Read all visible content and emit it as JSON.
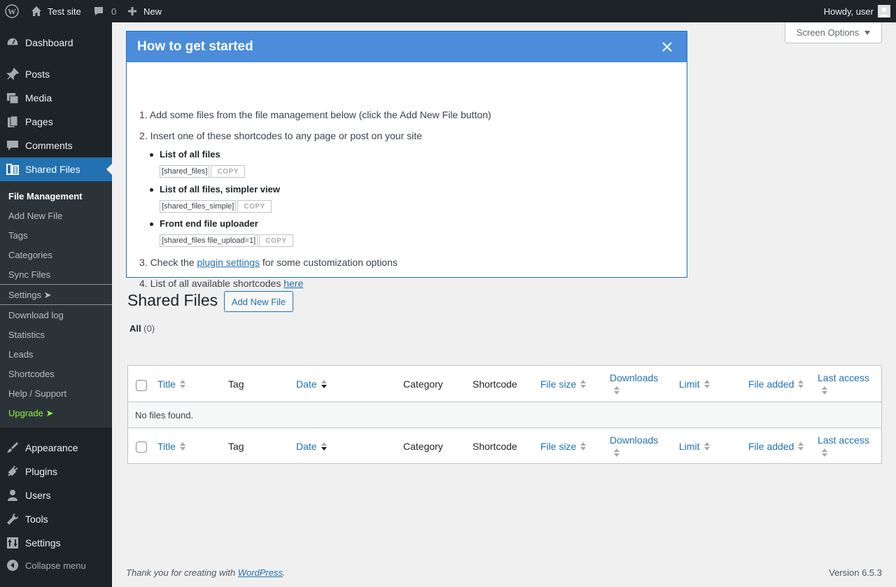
{
  "adminbar": {
    "site_name": "Test site",
    "comments_count": "0",
    "new_label": "New",
    "howdy": "Howdy, user"
  },
  "sidebar": {
    "items": [
      {
        "label": "Dashboard",
        "icon": "dashboard-icon"
      },
      {
        "label": "Posts",
        "icon": "pin-icon"
      },
      {
        "label": "Media",
        "icon": "media-icon"
      },
      {
        "label": "Pages",
        "icon": "pages-icon"
      },
      {
        "label": "Comments",
        "icon": "comment-icon"
      },
      {
        "label": "Shared Files",
        "icon": "shared-files-icon"
      },
      {
        "label": "Appearance",
        "icon": "brush-icon"
      },
      {
        "label": "Plugins",
        "icon": "plug-icon"
      },
      {
        "label": "Users",
        "icon": "user-icon"
      },
      {
        "label": "Tools",
        "icon": "wrench-icon"
      },
      {
        "label": "Settings",
        "icon": "settings-icon"
      },
      {
        "label": "Collapse menu",
        "icon": "collapse-icon"
      }
    ],
    "submenu": [
      "File Management",
      "Add New File",
      "Tags",
      "Categories",
      "Sync Files",
      "Settings ➤",
      "Download log",
      "Statistics",
      "Leads",
      "Shortcodes",
      "Help / Support",
      "Upgrade ➤"
    ]
  },
  "screen_options": "Screen Options",
  "getstarted": {
    "title": "How to get started",
    "step1": "1. Add some files from the file management below (click the Add New File button)",
    "step2": "2. Insert one of these shortcodes to any page or post on your site",
    "shortcodes": [
      {
        "title": "List of all files",
        "code": "[shared_files]",
        "copy": "COPY"
      },
      {
        "title": "List of all files, simpler view",
        "code": "[shared_files_simple]",
        "copy": "COPY"
      },
      {
        "title": "Front end file uploader",
        "code": "[shared_files file_upload=1]",
        "copy": "COPY"
      }
    ],
    "step3_prefix": "3. Check the ",
    "step3_link": "plugin settings",
    "step3_suffix": " for some customization options",
    "step4_prefix": "4. List of all available shortcodes ",
    "step4_link": "here"
  },
  "page": {
    "title": "Shared Files",
    "add_new": "Add New File",
    "filter_all": "All",
    "filter_count": "(0)"
  },
  "table": {
    "columns": [
      "Title",
      "Tag",
      "Date",
      "Category",
      "Shortcode",
      "File size",
      "Downloads",
      "Limit",
      "File added",
      "Last access"
    ],
    "empty_message": "No files found."
  },
  "footer": {
    "thanks_prefix": "Thank you for creating with ",
    "thanks_link": "WordPress",
    "thanks_suffix": ".",
    "version": "Version 6.5.3"
  }
}
